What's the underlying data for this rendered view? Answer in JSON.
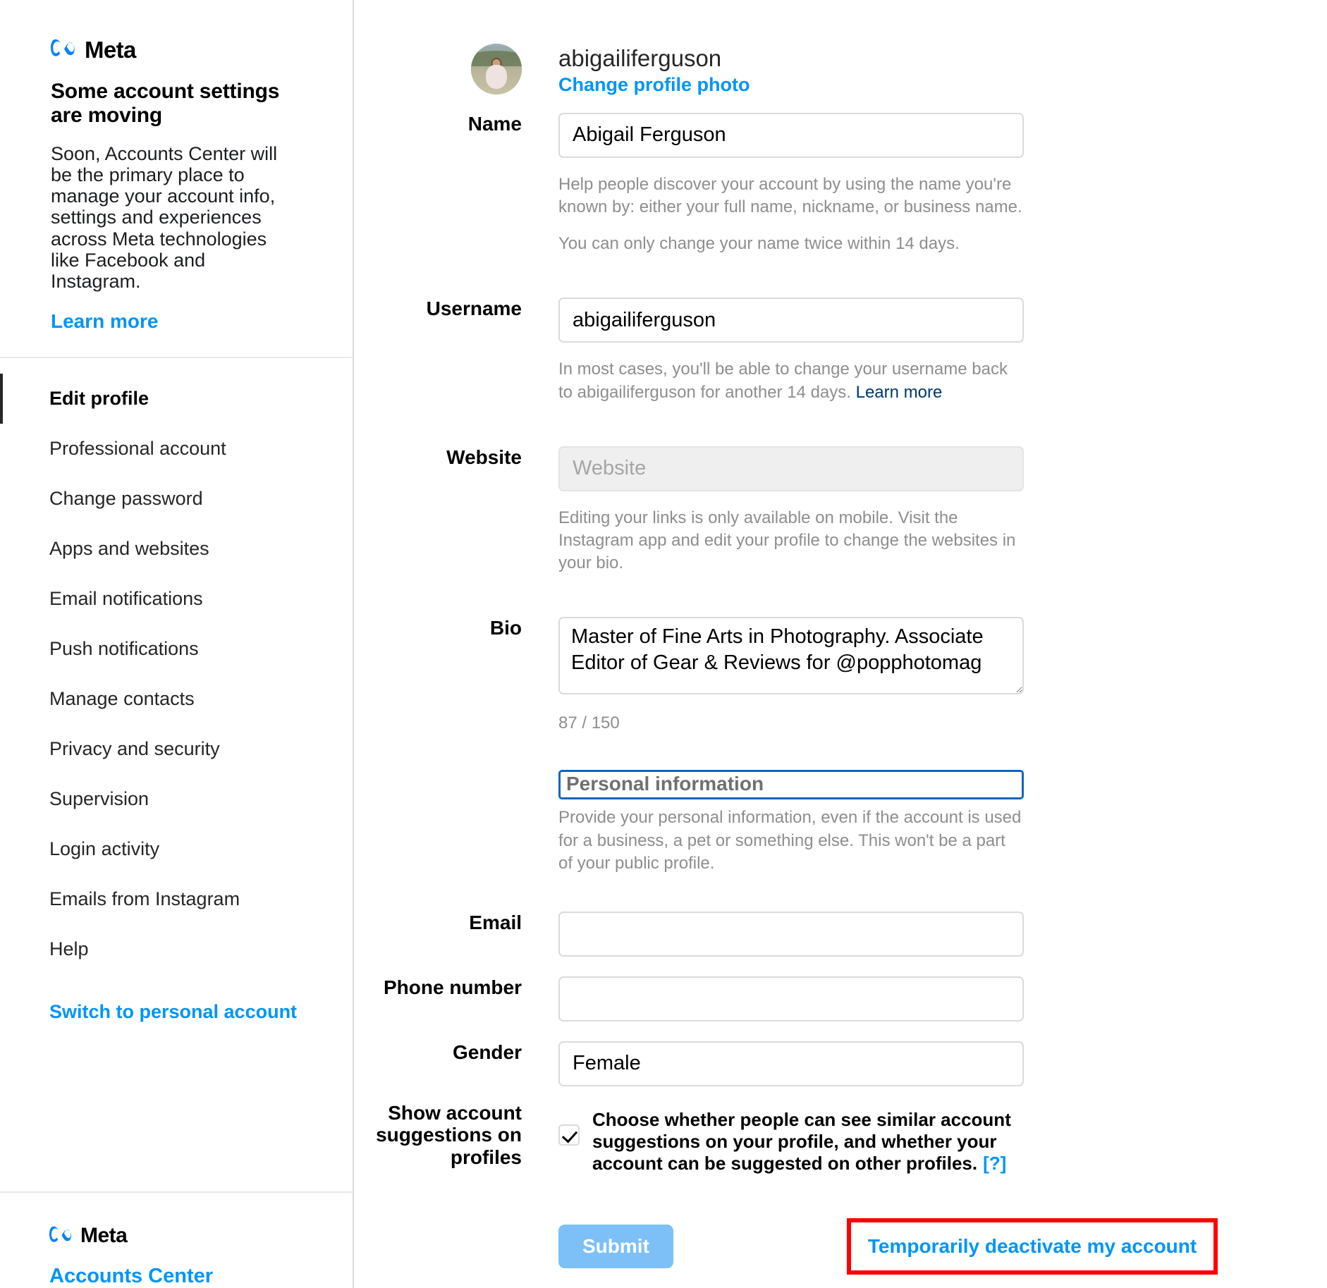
{
  "sidebar": {
    "brand": "Meta",
    "promo": {
      "title": "Some account settings are moving",
      "body": "Soon, Accounts Center will be the primary place to manage your account info, settings and experiences across Meta technologies like Facebook and Instagram.",
      "learn_more": "Learn more"
    },
    "items": [
      {
        "label": "Edit profile",
        "active": true
      },
      {
        "label": "Professional account",
        "active": false
      },
      {
        "label": "Change password",
        "active": false
      },
      {
        "label": "Apps and websites",
        "active": false
      },
      {
        "label": "Email notifications",
        "active": false
      },
      {
        "label": "Push notifications",
        "active": false
      },
      {
        "label": "Manage contacts",
        "active": false
      },
      {
        "label": "Privacy and security",
        "active": false
      },
      {
        "label": "Supervision",
        "active": false
      },
      {
        "label": "Login activity",
        "active": false
      },
      {
        "label": "Emails from Instagram",
        "active": false
      },
      {
        "label": "Help",
        "active": false
      }
    ],
    "switch_account": "Switch to personal account",
    "footer_brand": "Meta",
    "accounts_center": "Accounts Center"
  },
  "profile": {
    "username": "abigailiferguson",
    "change_photo": "Change profile photo",
    "avatar_alt": "profile-photo"
  },
  "fields": {
    "name": {
      "label": "Name",
      "value": "Abigail Ferguson",
      "help_1": "Help people discover your account by using the name you're known by: either your full name, nickname, or business name.",
      "help_2": "You can only change your name twice within 14 days."
    },
    "username": {
      "label": "Username",
      "value": "abigailiferguson",
      "help_prefix": "In most cases, you'll be able to change your username back to abigailiferguson for another 14 days.",
      "help_link": "Learn more"
    },
    "website": {
      "label": "Website",
      "value": "",
      "placeholder": "Website",
      "help": "Editing your links is only available on mobile. Visit the Instagram app and edit your profile to change the websites in your bio."
    },
    "bio": {
      "label": "Bio",
      "value": "Master of Fine Arts in Photography. Associate Editor of Gear & Reviews for @popphotomag",
      "counter": "87 / 150"
    },
    "personal_information": {
      "title": "Personal information",
      "help": "Provide your personal information, even if the account is used for a business, a pet or something else. This won't be a part of your public profile."
    },
    "email": {
      "label": "Email",
      "value": "",
      "placeholder": ""
    },
    "phone": {
      "label": "Phone number",
      "value": "",
      "placeholder": ""
    },
    "gender": {
      "label": "Gender",
      "value": "Female",
      "placeholder": ""
    },
    "suggestions": {
      "label": "Show account suggestions on profiles",
      "checked": true,
      "text": "Choose whether people can see similar account suggestions on your profile, and whether your account can be suggested on other profiles.",
      "help_link": "[?]"
    }
  },
  "actions": {
    "submit": "Submit",
    "deactivate": "Temporarily deactivate my account"
  },
  "colors": {
    "link_blue": "#0095f6",
    "submit_blue": "#7cc0f7",
    "highlight_red": "#ff0000",
    "focus_blue": "#1464c0",
    "muted_gray": "#8e8e8e"
  }
}
